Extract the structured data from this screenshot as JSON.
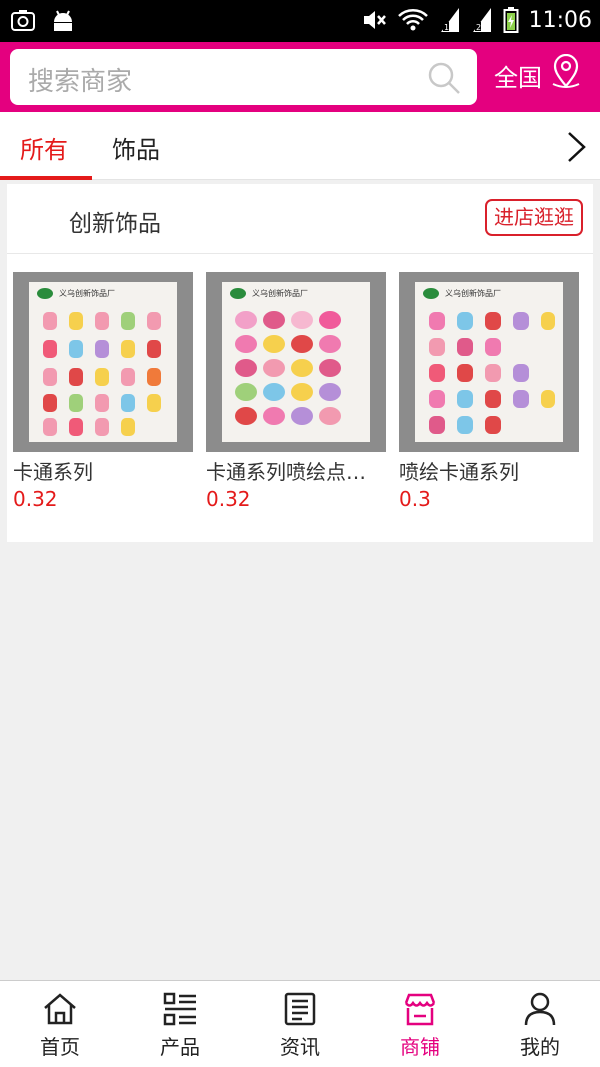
{
  "status_bar": {
    "time": "11:06"
  },
  "header": {
    "search_placeholder": "搜索商家",
    "region_label": "全国"
  },
  "tabs": [
    {
      "label": "所有",
      "active": true
    },
    {
      "label": "饰品",
      "active": false
    }
  ],
  "store": {
    "name": "创新饰品",
    "visit_button": "进店逛逛",
    "products": [
      {
        "name": "卡通系列",
        "price": "0.32",
        "board_title": "义乌创新饰品厂"
      },
      {
        "name": "卡通系列喷绘点…",
        "price": "0.32",
        "board_title": "义乌创新饰品厂"
      },
      {
        "name": "喷绘卡通系列",
        "price": "0.3",
        "board_title": "义乌创新饰品厂"
      }
    ]
  },
  "bottom_nav": [
    {
      "label": "首页",
      "icon": "home-icon",
      "active": false
    },
    {
      "label": "产品",
      "icon": "list-icon",
      "active": false
    },
    {
      "label": "资讯",
      "icon": "news-icon",
      "active": false
    },
    {
      "label": "商铺",
      "icon": "shop-icon",
      "active": true
    },
    {
      "label": "我的",
      "icon": "user-icon",
      "active": false
    }
  ],
  "colors": {
    "brand": "#e4007f",
    "accent_red": "#e41a1a"
  }
}
